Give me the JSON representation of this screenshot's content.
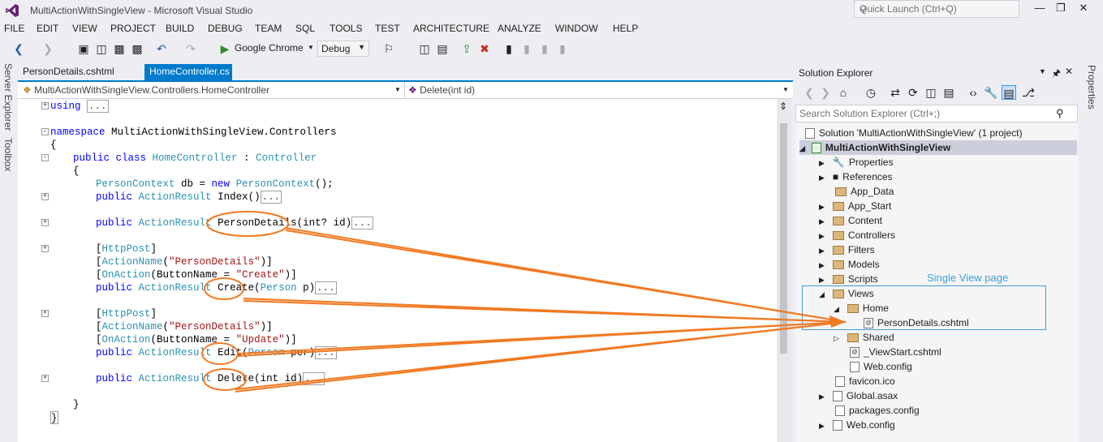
{
  "window": {
    "title": "MultiActionWithSingleView - Microsoft Visual Studio",
    "quick_launch_placeholder": "Quick Launch (Ctrl+Q)"
  },
  "menu": [
    "FILE",
    "EDIT",
    "VIEW",
    "PROJECT",
    "BUILD",
    "DEBUG",
    "TEAM",
    "SQL",
    "TOOLS",
    "TEST",
    "ARCHITECTURE",
    "ANALYZE",
    "WINDOW",
    "HELP"
  ],
  "toolbar": {
    "browser": "Google Chrome",
    "config": "Debug"
  },
  "side_panels": {
    "left_top": "Server Explorer",
    "left_bottom": "Toolbox",
    "right": "Properties"
  },
  "tabs": [
    {
      "label": "PersonDetails.cshtml",
      "active": false
    },
    {
      "label": "HomeController.cs",
      "active": true
    }
  ],
  "nav": {
    "class": "MultiActionWithSingleView.Controllers.HomeController",
    "member": "Delete(int id)"
  },
  "code": {
    "l1_kw": "using",
    "l1_coll": "...",
    "l2_kw": "namespace",
    "l2_rest": " MultiActionWithSingleView.Controllers",
    "l3": "{",
    "l4_kw": "public class",
    "l4_ty": "HomeController",
    "l4_mid": " : ",
    "l4_base": "Controller",
    "l5": "{",
    "l6_ty": "PersonContext",
    "l6_mid": " db = ",
    "l6_kw": "new",
    "l6_ty2": "PersonContext",
    "l6_end": "();",
    "l7_kw": "public",
    "l7_ty": "ActionResult",
    "l7_name": "Index()",
    "l7_coll": "...",
    "l8_kw": "public",
    "l8_ty": "ActionResult",
    "l8_name": "PersonDetails",
    "l8_args": "(int? id)",
    "l8_coll": "...",
    "l9_a": "[",
    "l9_ty": "HttpPost",
    "l9_b": "]",
    "l10_a": "[",
    "l10_ty": "ActionName",
    "l10_b": "(",
    "l10_st": "\"PersonDetails\"",
    "l10_c": ")]",
    "l11_a": "[",
    "l11_ty": "OnAction",
    "l11_b": "(ButtonName = ",
    "l11_st": "\"Create\"",
    "l11_c": ")]",
    "l12_kw": "public",
    "l12_ty": "ActionResult",
    "l12_name": "Create",
    "l12_b": "(",
    "l12_ty2": "Person",
    "l12_args": " p)",
    "l12_coll": "...",
    "l13_a": "[",
    "l13_ty": "HttpPost",
    "l13_b": "]",
    "l14_a": "[",
    "l14_ty": "ActionName",
    "l14_b": "(",
    "l14_st": "\"PersonDetails\"",
    "l14_c": ")]",
    "l15_a": "[",
    "l15_ty": "OnAction",
    "l15_b": "(ButtonName = ",
    "l15_st": "\"Update\"",
    "l15_c": ")]",
    "l16_kw": "public",
    "l16_ty": "ActionResult",
    "l16_name": "Edit",
    "l16_b": "(",
    "l16_ty2": "Person",
    "l16_args": " per)",
    "l16_coll": "...",
    "l17_kw": "public",
    "l17_ty": "ActionResult",
    "l17_name": "Delete",
    "l17_args": "(int id)",
    "l17_coll": "...",
    "l18": "}",
    "l19": "}"
  },
  "solution_explorer": {
    "title": "Solution Explorer",
    "search_placeholder": "Search Solution Explorer (Ctrl+;)",
    "annotation": "Single View page",
    "items": [
      "Solution 'MultiActionWithSingleView' (1 project)",
      "MultiActionWithSingleView",
      "Properties",
      "References",
      "App_Data",
      "App_Start",
      "Content",
      "Controllers",
      "Filters",
      "Models",
      "Scripts",
      "Views",
      "Home",
      "PersonDetails.cshtml",
      "Shared",
      "_ViewStart.cshtml",
      "Web.config",
      "favicon.ico",
      "Global.asax",
      "packages.config",
      "Web.config"
    ]
  },
  "colors": {
    "accent": "#007ACC",
    "annotation_orange": "#F07A22",
    "annotation_blue": "#3BA0D8"
  }
}
